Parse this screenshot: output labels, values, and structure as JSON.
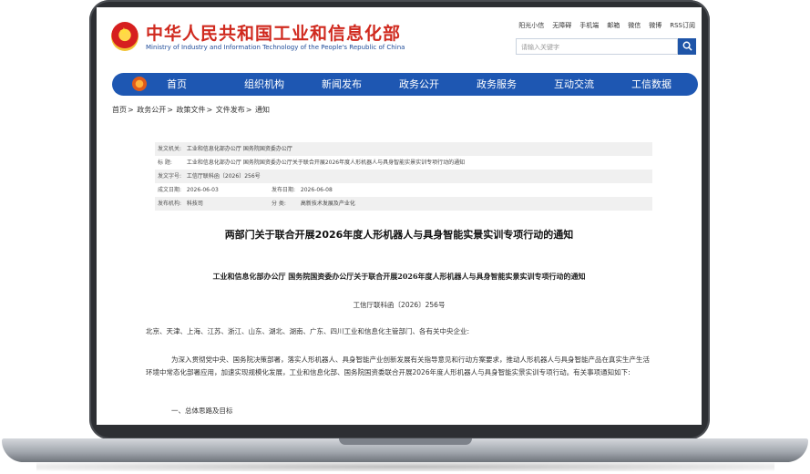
{
  "header": {
    "site_title": "中华人民共和国工业和信息化部",
    "site_subtitle": "Ministry of Industry and Information Technology of the People's Republic of China",
    "toplinks": [
      "阳光小信",
      "无障碍",
      "手机端",
      "邮箱",
      "微信",
      "微博",
      "RSS订阅"
    ],
    "search_placeholder": "请输入关键字"
  },
  "nav": {
    "items": [
      "首页",
      "组织机构",
      "新闻发布",
      "政务公开",
      "政务服务",
      "互动交流",
      "工信数据"
    ]
  },
  "breadcrumb": [
    "首页",
    "政务公开",
    "政策文件",
    "文件发布",
    "通知"
  ],
  "meta": {
    "issuer_label": "发文机关:",
    "issuer": "工业和信息化部办公厅  国务院国资委办公厅",
    "title_label": "标    题:",
    "title": "工业和信息化部办公厅  国务院国资委办公厅关于联合开展2026年度人形机器人与具身智能实景实训专项行动的通知",
    "number_label": "发文字号:",
    "number": "工信厅联科函〔2026〕256号",
    "written_label": "成文日期:",
    "written": "2026-06-03",
    "published_label": "发布日期:",
    "published": "2026-06-08",
    "org_label": "发布机构:",
    "org": "科技司",
    "category_label": "分    类:",
    "category": "高新技术发展及产业化"
  },
  "document": {
    "title": "两部门关于联合开展2026年度人形机器人与具身智能实景实训专项行动的通知",
    "subtitle": "工业和信息化部办公厅  国务院国资委办公厅关于联合开展2026年度人形机器人与具身智能实景实训专项行动的通知",
    "number": "工信厅联科函〔2026〕256号",
    "recipients": "北京、天津、上海、江苏、浙江、山东、湖北、湖南、广东、四川工业和信息化主管部门、各有关中央企业:",
    "paragraph1": "为深入贯彻党中央、国务院决策部署，落实人形机器人、具身智能产业创新发展有关指导意见和行动方案要求，推动人形机器人与具身智能产品在真实生产生活环境中常态化部署应用，加速实现规模化发展，工业和信息化部、国务院国资委联合开展2026年度人形机器人与具身智能实景实训专项行动。有关事项通知如下:",
    "section1": "一、总体思路及目标"
  },
  "colors": {
    "brand_red": "#d02a1f",
    "nav_blue": "#1e57b2"
  },
  "icons": {
    "search": "search-icon",
    "emblem": "national-emblem-icon",
    "nav_logo": "ministry-logo-icon"
  }
}
